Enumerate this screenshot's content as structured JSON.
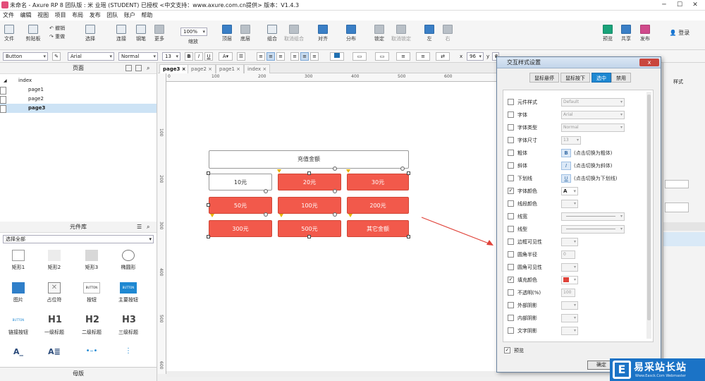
{
  "window": {
    "title": "未命名 - Axure RP 8 团队版 : 米 业瑶 (STUDENT) 已授权     <中文支持：www.axure.com.cn提供> 版本：V1.4.3"
  },
  "menu": [
    "文件",
    "编辑",
    "视图",
    "项目",
    "布局",
    "发布",
    "团队",
    "账户",
    "帮助"
  ],
  "toolbar": {
    "file": "文件",
    "clipboard": "剪贴板",
    "undo": "撤销",
    "redo": "重做",
    "select": "选择",
    "connect": "连接",
    "pen": "钢笔",
    "more": "更多",
    "zoom_value": "100%",
    "zoom_label": "缩放",
    "top": "顶层",
    "bottom": "底层",
    "group": "组合",
    "ungroup": "取消组合",
    "align": "对齐",
    "distribute": "分布",
    "lock": "锁定",
    "unlock": "取消锁定",
    "left": "左",
    "right": "右",
    "preview": "预览",
    "share": "共享",
    "publish": "发布",
    "login": "登录"
  },
  "format": {
    "widget_type": "Button",
    "font": "Arial",
    "style": "Normal",
    "size": "13",
    "bold": "B",
    "italic": "I",
    "underline": "U",
    "x_label": "x",
    "x_value": "96",
    "y_label": "y",
    "y_value": "2"
  },
  "pages_panel": {
    "title": "页面",
    "root": "index",
    "pages": [
      "page1",
      "page2",
      "page3"
    ]
  },
  "library_panel": {
    "title": "元件库",
    "selector": "选择全部",
    "items": [
      "矩形1",
      "矩形2",
      "矩形3",
      "椭圆形",
      "图片",
      "占位符",
      "按钮",
      "主要按钮",
      "链接按钮",
      "一级标题",
      "二级标题",
      "三级标题"
    ],
    "h1": "H1",
    "h2": "H2",
    "h3": "H3",
    "btn_text": "BUTTON"
  },
  "master_panel": {
    "title": "母版"
  },
  "tabs": [
    "page3",
    "page2",
    "page1",
    "index"
  ],
  "ruler_h": [
    "0",
    "100",
    "200",
    "300",
    "400",
    "500",
    "600"
  ],
  "ruler_v": [
    "100",
    "200",
    "300",
    "400",
    "500",
    "600"
  ],
  "canvas": {
    "header": "充值金额",
    "buttons": [
      "10元",
      "20元",
      "30元",
      "50元",
      "100元",
      "200元",
      "300元",
      "500元",
      "其它金额"
    ]
  },
  "colors": {
    "accent_red": "#f2594b",
    "dialog_tab": "#1e88d2",
    "fill_swatch": "#e0433a"
  },
  "dialog": {
    "title": "交互样式设置",
    "close": "x",
    "tabs": [
      "鼠标悬停",
      "鼠标按下",
      "选中",
      "禁用"
    ],
    "active_tab": "选中",
    "rows": [
      {
        "label": "元件样式",
        "checked": false,
        "value": "Default"
      },
      {
        "label": "字体",
        "checked": false,
        "value": "Arial"
      },
      {
        "label": "字体类型",
        "checked": false,
        "value": "Normal"
      },
      {
        "label": "字体尺寸",
        "checked": false,
        "value": "13"
      },
      {
        "label": "粗体",
        "checked": false,
        "hint": "(点击切换为粗体)",
        "btn": "B"
      },
      {
        "label": "斜体",
        "checked": false,
        "hint": "(点击切换为斜体)",
        "btn": "I"
      },
      {
        "label": "下划线",
        "checked": false,
        "hint": "(点击切换为下划线)",
        "btn": "U"
      },
      {
        "label": "字体颜色",
        "checked": true,
        "value": "A"
      },
      {
        "label": "线段颜色",
        "checked": false
      },
      {
        "label": "线宽",
        "checked": false
      },
      {
        "label": "线型",
        "checked": false
      },
      {
        "label": "边框可见性",
        "checked": false
      },
      {
        "label": "圆角半径",
        "checked": false,
        "value": "0"
      },
      {
        "label": "圆角可见性",
        "checked": false
      },
      {
        "label": "填充颜色",
        "checked": true
      },
      {
        "label": "不透明(%)",
        "checked": false,
        "value": "100"
      },
      {
        "label": "外部阴影",
        "checked": false
      },
      {
        "label": "内部阴影",
        "checked": false
      },
      {
        "label": "文字阴影",
        "checked": false
      }
    ],
    "preview_label": "预览",
    "preview_checked": true,
    "ok": "确定"
  },
  "right_panel": {
    "style_tab": "样式"
  },
  "brand": {
    "name": "易采站长站",
    "sub": "Www.Easck.Com Webmaster",
    "logo": "E"
  }
}
